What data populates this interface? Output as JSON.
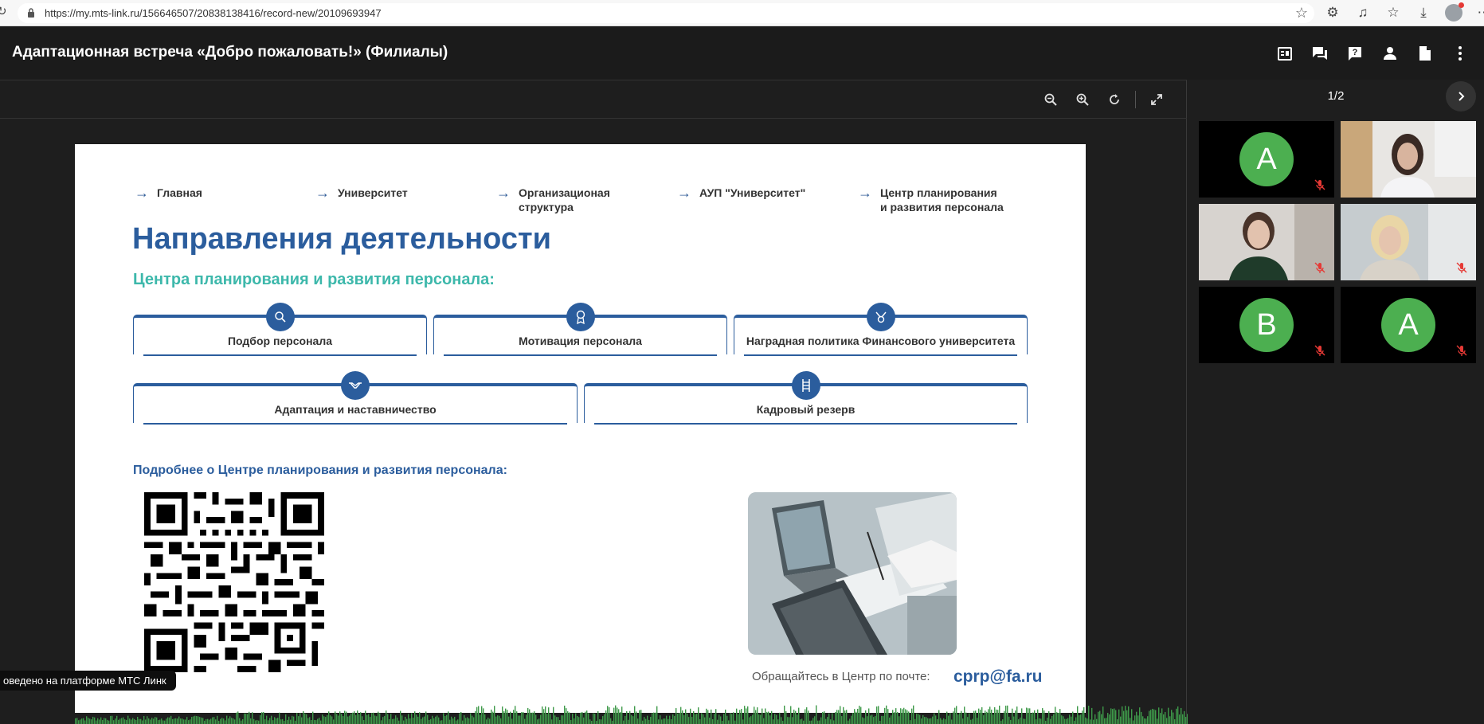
{
  "browser": {
    "url": "https://my.mts-link.ru/156646507/20838138416/record-new/20109693947"
  },
  "header": {
    "title": "Адаптационная встреча «Добро пожаловать!» (Филиалы)"
  },
  "slide": {
    "breadcrumbs": [
      {
        "label": "Главная"
      },
      {
        "label": "Университет"
      },
      {
        "label": "Организационая\nструктура"
      },
      {
        "label": "АУП \"Университет\""
      },
      {
        "label": "Центр планирования\nи развития персонала"
      }
    ],
    "title": "Направления деятельности",
    "subtitle": "Центра планирования и развития персонала:",
    "cards": [
      {
        "label": "Подбор персонала",
        "icon": "search-icon"
      },
      {
        "label": "Мотивация персонала",
        "icon": "medal-icon"
      },
      {
        "label": "Наградная политика Финансового университета",
        "icon": "award-icon"
      },
      {
        "label": "Адаптация и наставничество",
        "icon": "handshake-icon"
      },
      {
        "label": "Кадровый резерв",
        "icon": "ladder-icon"
      }
    ],
    "more_text": "Подробнее о Центре планирования и развития персонала:",
    "contact_text": "Обращайтесь в Центр по почте:",
    "email": "cprp@fa.ru"
  },
  "caption": "оведено на платформе МТС Линк",
  "panel": {
    "pager": "1/2",
    "participants": [
      {
        "initial": "А",
        "type": "avatar",
        "muted": true
      },
      {
        "initial": "",
        "type": "video",
        "muted": false
      },
      {
        "initial": "",
        "type": "video",
        "muted": true
      },
      {
        "initial": "",
        "type": "video",
        "muted": true
      },
      {
        "initial": "В",
        "type": "avatar",
        "muted": true
      },
      {
        "initial": "А",
        "type": "avatar",
        "muted": true
      }
    ]
  },
  "colors": {
    "accent": "#2b5d9d",
    "teal": "#3db8ab",
    "avatar": "#4caf50",
    "muted_mic": "#e53935"
  }
}
